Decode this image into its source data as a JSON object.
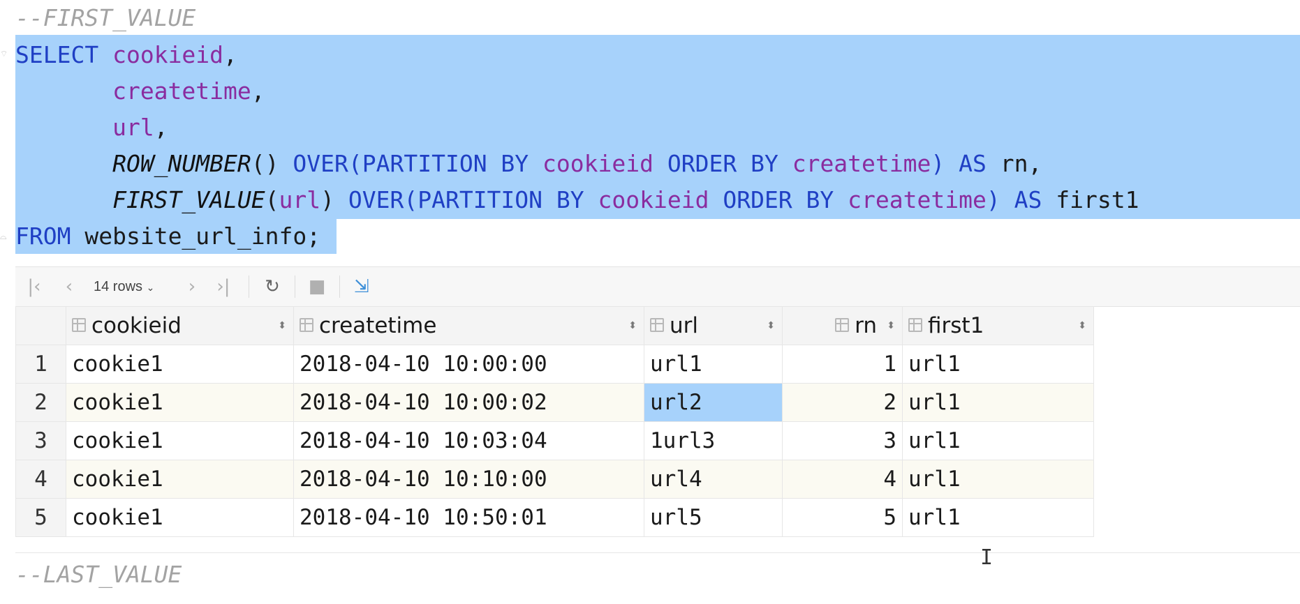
{
  "editor": {
    "comment_first": "--FIRST_VALUE",
    "comment_last": "--LAST_VALUE",
    "sql": {
      "select_kw": "SELECT",
      "col_cookieid": "cookieid",
      "col_createtime": "createtime",
      "col_url": "url",
      "comma": ",",
      "fn_row_number": "ROW_NUMBER",
      "fn_first_value": "FIRST_VALUE",
      "empty_parens": "()",
      "open_paren": "(",
      "close_paren": ")",
      "over_kw": "OVER",
      "partition_by_kw": "PARTITION BY",
      "order_by_kw": "ORDER BY",
      "as_kw": "AS",
      "alias_rn": "rn",
      "alias_first1": "first1",
      "from_kw": "FROM",
      "table_name": "website_url_info",
      "semicolon": ";"
    },
    "selection_color": "#a7d2fb"
  },
  "results": {
    "toolbar": {
      "first_icon": "first-page-icon",
      "prev_icon": "prev-page-icon",
      "rows_label": "14 rows",
      "next_icon": "next-page-icon",
      "last_icon": "last-page-icon",
      "refresh_icon": "refresh-icon",
      "stop_icon": "stop-icon",
      "pin_icon": "pin-icon"
    },
    "columns": [
      "cookieid",
      "createtime",
      "url",
      "rn",
      "first1"
    ],
    "rows": [
      {
        "n": "1",
        "cookieid": "cookie1",
        "createtime": "2018-04-10 10:00:00",
        "url": "url1",
        "rn": "1",
        "first1": "url1"
      },
      {
        "n": "2",
        "cookieid": "cookie1",
        "createtime": "2018-04-10 10:00:02",
        "url": "url2",
        "rn": "2",
        "first1": "url1"
      },
      {
        "n": "3",
        "cookieid": "cookie1",
        "createtime": "2018-04-10 10:03:04",
        "url": "1url3",
        "rn": "3",
        "first1": "url1"
      },
      {
        "n": "4",
        "cookieid": "cookie1",
        "createtime": "2018-04-10 10:10:00",
        "url": "url4",
        "rn": "4",
        "first1": "url1"
      },
      {
        "n": "5",
        "cookieid": "cookie1",
        "createtime": "2018-04-10 10:50:01",
        "url": "url5",
        "rn": "5",
        "first1": "url1"
      }
    ]
  }
}
